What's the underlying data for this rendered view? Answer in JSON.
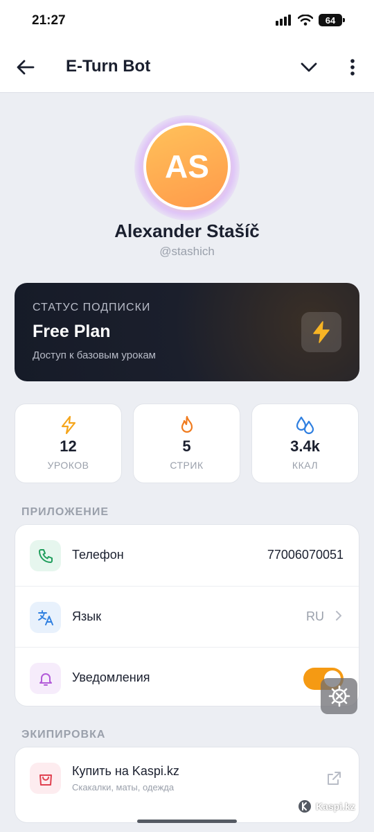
{
  "status_bar": {
    "time": "21:27",
    "battery": "64"
  },
  "app_bar": {
    "title": "E-Turn Bot"
  },
  "profile": {
    "initials": "AS",
    "name": "Alexander Stašíč",
    "handle": "@stashich"
  },
  "subscription": {
    "label": "СТАТУС ПОДПИСКИ",
    "plan": "Free Plan",
    "description": "Доступ к базовым урокам"
  },
  "stats": [
    {
      "icon": "bolt-icon",
      "value": "12",
      "label": "УРОКОВ",
      "color": "#f5a51b"
    },
    {
      "icon": "flame-icon",
      "value": "5",
      "label": "СТРИК",
      "color": "#f07b1e"
    },
    {
      "icon": "drops-icon",
      "value": "3.4k",
      "label": "ККАЛ",
      "color": "#2f7fe0"
    }
  ],
  "sections": {
    "app": "ПРИЛОЖЕНИЕ",
    "equipment": "ЭКИПИРОВКА"
  },
  "settings": [
    {
      "icon": "phone-icon",
      "label": "Телефон",
      "value": "77006070051"
    },
    {
      "icon": "translate-icon",
      "label": "Язык",
      "value": "RU"
    },
    {
      "icon": "bell-icon",
      "label": "Уведомления",
      "toggle": true
    }
  ],
  "equipment": {
    "icon": "shopping-bag-icon",
    "title": "Купить на Kaspi.kz",
    "subtitle": "Скакалки, маты, одежда"
  },
  "watermark": {
    "text": "Kaspi.kz"
  },
  "colors": {
    "accent": "#f59a13",
    "dark_card": "#1b1f2c",
    "background": "#eceef3"
  }
}
